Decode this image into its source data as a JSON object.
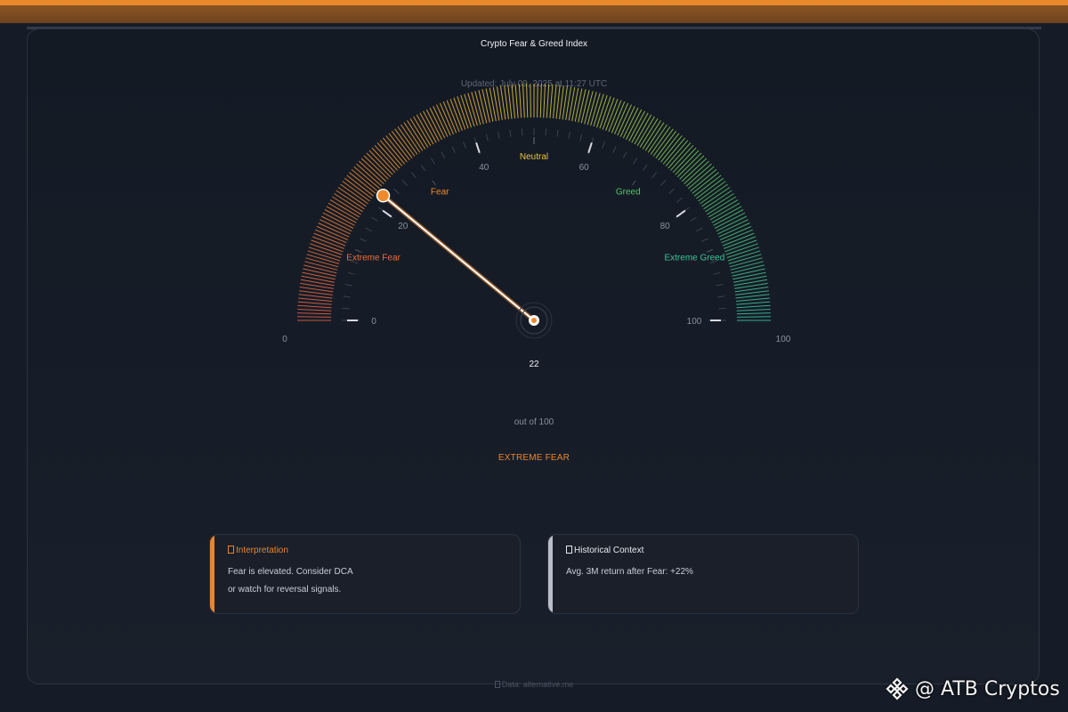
{
  "header": {
    "title": "Crypto Fear & Greed Index",
    "updated": "Updated: July 09, 2025 at 11:27 UTC"
  },
  "gauge": {
    "value": 22,
    "min": 0,
    "max": 100,
    "value_text": "22",
    "out_of": "out of 100",
    "classification": "EXTREME FEAR",
    "scale_labels": [
      "0",
      "20",
      "40",
      "60",
      "80",
      "100"
    ],
    "end_labels": [
      "0",
      "100"
    ],
    "zones": [
      {
        "label": "Extreme Fear",
        "color": "#e8703a"
      },
      {
        "label": "Fear",
        "color": "#f08a2e"
      },
      {
        "label": "Neutral",
        "color": "#eac53a"
      },
      {
        "label": "Greed",
        "color": "#52c46a"
      },
      {
        "label": "Extreme Greed",
        "color": "#3cc49a"
      }
    ],
    "colors": {
      "needle_knob": "#f0892b",
      "needle": "#ffffff",
      "tick": "#3a4250"
    }
  },
  "cards": [
    {
      "title": "Interpretation",
      "icon": "bulb-icon",
      "lines": [
        "Fear is elevated. Consider DCA",
        "or watch for reversal signals."
      ],
      "accent": "#e9852c",
      "title_color": "#e9852c"
    },
    {
      "title": "Historical Context",
      "icon": "chart-icon",
      "lines": [
        "Avg. 3M return after Fear: +22%"
      ],
      "accent": "#b9bec8",
      "title_color": "#e6e9ee"
    }
  ],
  "footer": {
    "source": "Data: alternative.me"
  },
  "watermark": {
    "text": "@ ATB Cryptos",
    "icon": "binance-logo-icon"
  }
}
